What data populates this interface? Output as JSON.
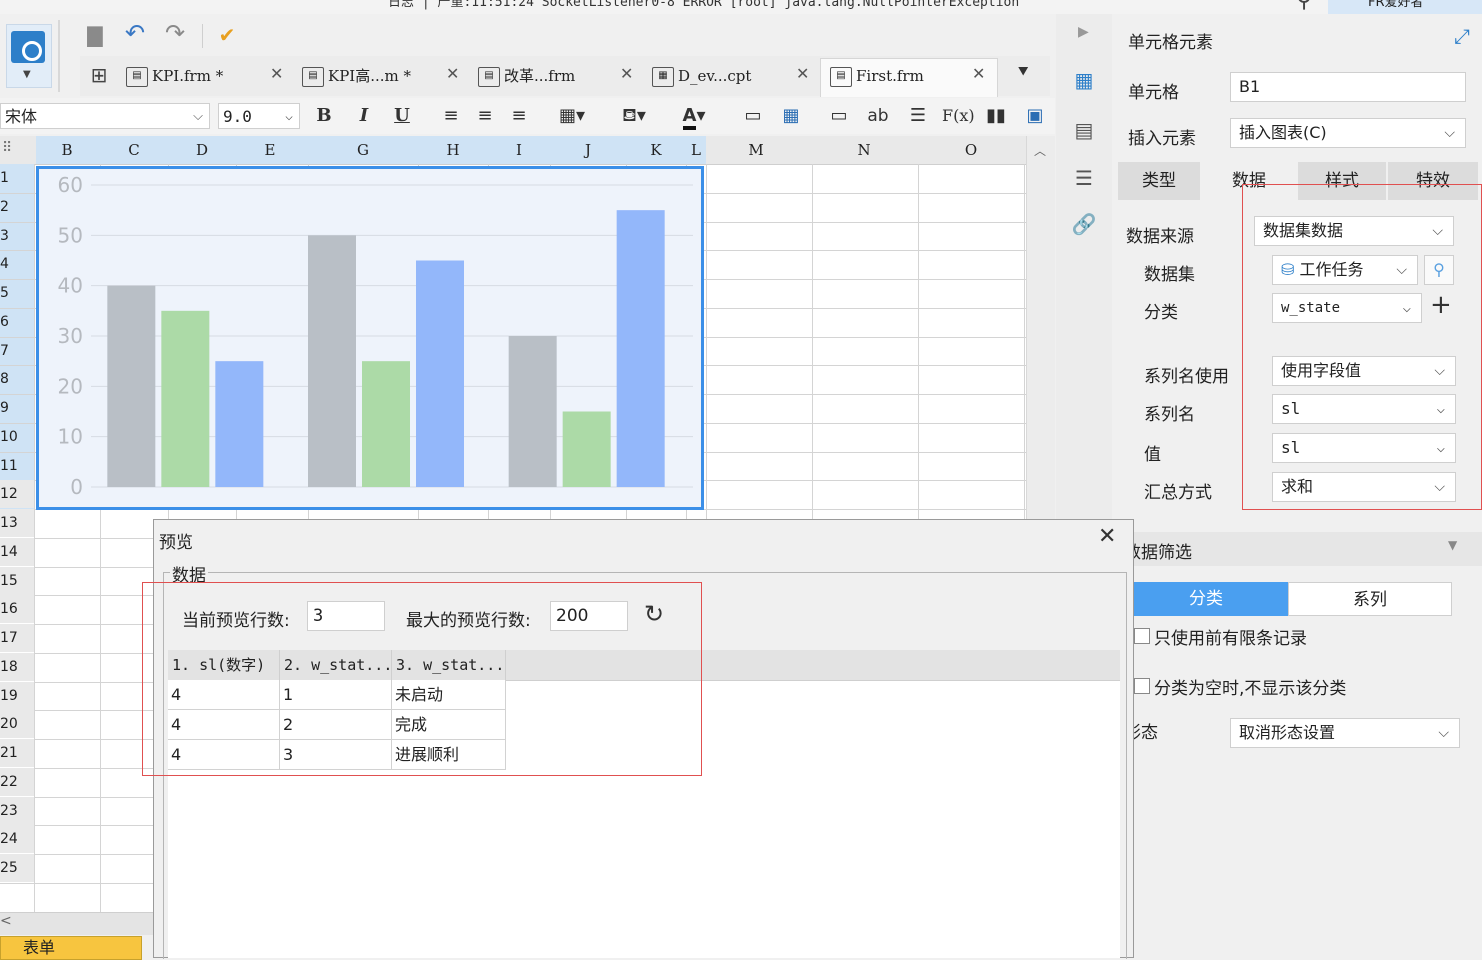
{
  "window": {
    "title_text": "日志 | 严重:11:51:24 SocketListener0-8 ERROR [root] java.lang.NullPointerException",
    "user_text": "FR爱好者"
  },
  "tabs": [
    {
      "label": "KPI.frm *"
    },
    {
      "label": "KPI高...m *"
    },
    {
      "label": "改革...frm"
    },
    {
      "label": "D_ev...cpt"
    },
    {
      "label": "First.frm"
    }
  ],
  "format_toolbar": {
    "font_name": "宋体",
    "font_size": "9.0",
    "bold_label": "B",
    "italic_label": "I",
    "underline_label": "U",
    "text_label": "ab",
    "formula_label": "F(x)"
  },
  "sheet": {
    "columns": [
      "B",
      "C",
      "D",
      "E",
      "G",
      "H",
      "I",
      "J",
      "K",
      "L",
      "M",
      "N",
      "O"
    ],
    "rows": [
      "1",
      "2",
      "3",
      "4",
      "5",
      "6",
      "7",
      "8",
      "9",
      "10",
      "11",
      "12",
      "13",
      "14",
      "15",
      "16",
      "17",
      "18",
      "19",
      "20",
      "21",
      "22",
      "23",
      "24",
      "25"
    ],
    "sheet_tab": "表单"
  },
  "chart_data": {
    "type": "bar",
    "categories": [
      "",
      "",
      ""
    ],
    "series": [
      {
        "values": [
          40,
          50,
          30
        ],
        "color": "#b9bfc6"
      },
      {
        "values": [
          35,
          25,
          15
        ],
        "color": "#acdaa7"
      },
      {
        "values": [
          25,
          45,
          55
        ],
        "color": "#93b7fa"
      }
    ],
    "yticks": [
      "0",
      "10",
      "20",
      "30",
      "40",
      "50",
      "60"
    ],
    "ylim": [
      0,
      60
    ],
    "grid": true,
    "legend": "none",
    "background": "#eef3fb"
  },
  "right_panel": {
    "header": "单元格元素",
    "cell_label": "单元格",
    "cell_value": "B1",
    "insert_label": "插入元素",
    "insert_value": "插入图表(C)",
    "tabs": [
      "类型",
      "数据",
      "样式",
      "特效"
    ],
    "data_source_label": "数据来源",
    "data_source_value": "数据集数据",
    "dataset_label": "数据集",
    "dataset_value": "工作任务",
    "category_label": "分类",
    "category_value": "w_state",
    "series_use_label": "系列名使用",
    "series_use_value": "使用字段值",
    "series_name_label": "系列名",
    "series_name_value": "sl",
    "value_label": "值",
    "value_value": "sl",
    "summary_label": "汇总方式",
    "summary_value": "求和",
    "filter_header": "数据筛选",
    "seg_category": "分类",
    "seg_series": "系列",
    "check_limit": "只使用前有限条记录",
    "check_empty": "分类为空时,不显示该分类",
    "state_label": "形态",
    "state_value": "取消形态设置"
  },
  "preview_dialog": {
    "title": "预览",
    "group_label": "数据",
    "current_rows_label": "当前预览行数:",
    "current_rows_value": "3",
    "max_rows_label": "最大的预览行数:",
    "max_rows_value": "200",
    "headers": [
      "1. sl(数字)",
      "2. w_stat...",
      "3. w_stat..."
    ],
    "rows": [
      [
        "4",
        "1",
        "未启动"
      ],
      [
        "4",
        "2",
        "完成"
      ],
      [
        "4",
        "3",
        "进展顺利"
      ]
    ]
  }
}
